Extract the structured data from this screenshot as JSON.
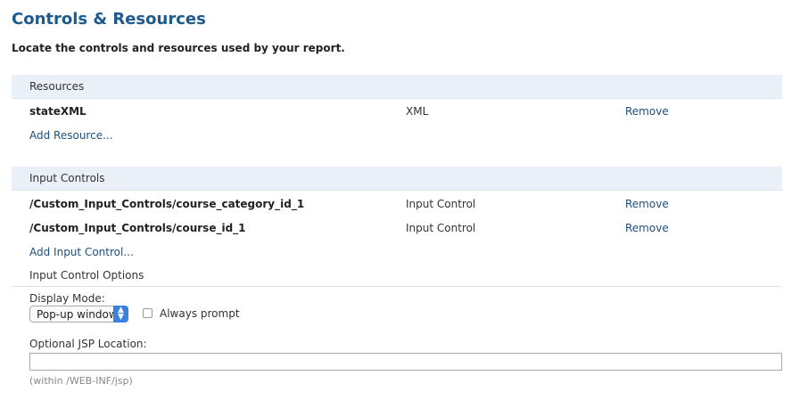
{
  "header": {
    "title": "Controls & Resources",
    "subtitle": "Locate the controls and resources used by your report."
  },
  "resources": {
    "section_label": "Resources",
    "items": [
      {
        "name": "stateXML",
        "type": "XML",
        "action": "Remove"
      }
    ],
    "add_label": "Add Resource..."
  },
  "input_controls": {
    "section_label": "Input Controls",
    "items": [
      {
        "name": "/Custom_Input_Controls/course_category_id_1",
        "type": "Input Control",
        "action": "Remove"
      },
      {
        "name": "/Custom_Input_Controls/course_id_1",
        "type": "Input Control",
        "action": "Remove"
      }
    ],
    "add_label": "Add Input Control...",
    "options_title": "Input Control Options"
  },
  "options": {
    "display_mode_label": "Display Mode:",
    "display_mode_value": "Pop-up window",
    "always_prompt_label": "Always prompt",
    "always_prompt_checked": false,
    "jsp_location_label": "Optional JSP Location:",
    "jsp_location_value": "",
    "jsp_hint": "(within /WEB-INF/jsp)"
  },
  "colors": {
    "title": "#1d5a8e",
    "link": "#1d4f7c",
    "section_header_bg": "#eaf0f7",
    "select_arrow_bg": "#3b82e0"
  }
}
